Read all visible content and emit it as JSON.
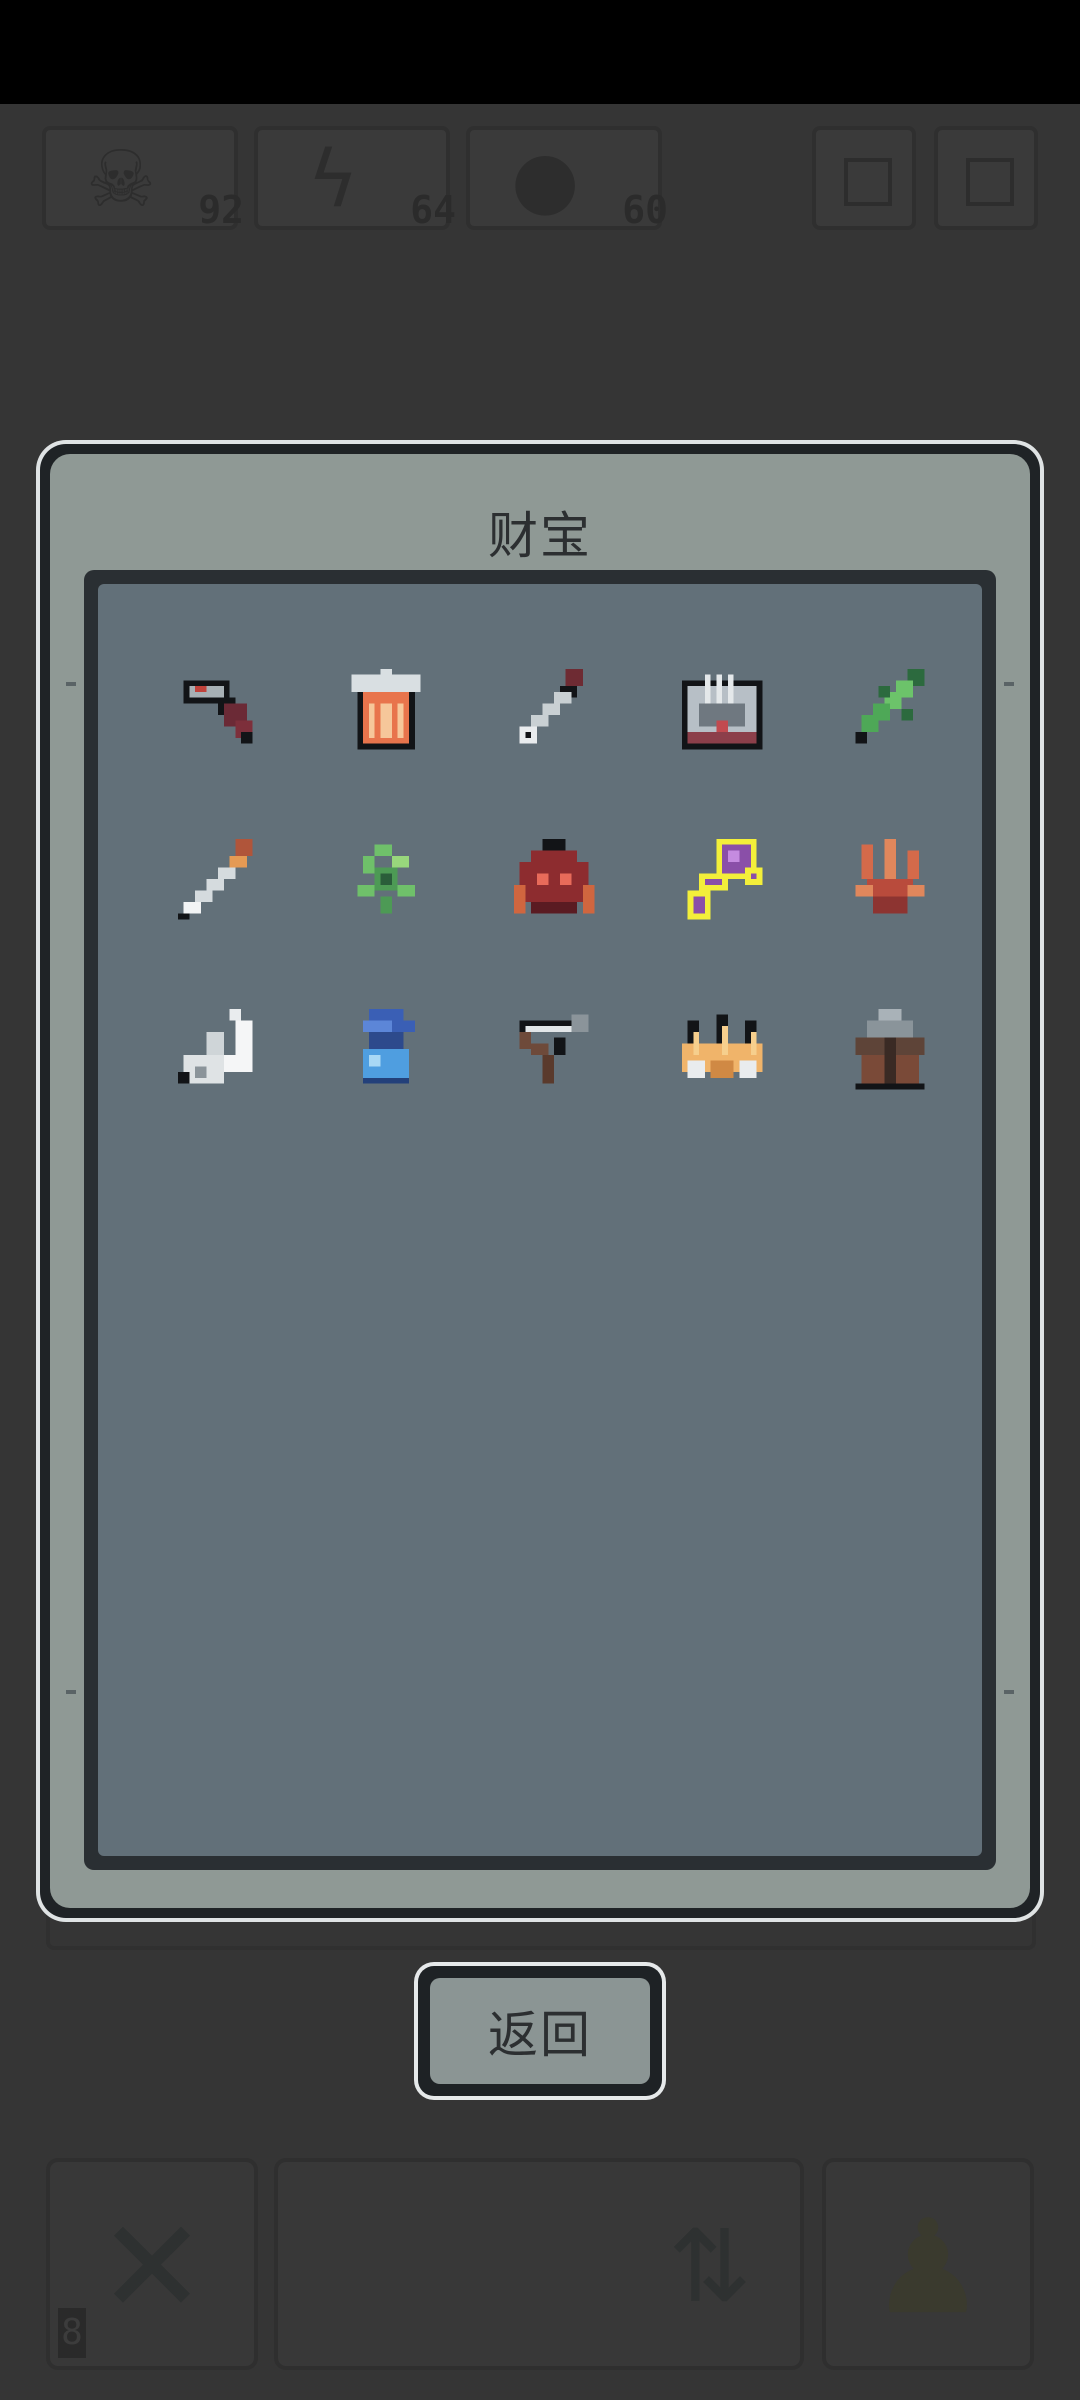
{
  "hud": {
    "stats": [
      {
        "icon": "skull-icon",
        "value": "92"
      },
      {
        "icon": "lightning-icon",
        "value": "64"
      },
      {
        "icon": "slime-icon",
        "value": "60"
      }
    ],
    "buttons": [
      {
        "icon": "map-icon"
      },
      {
        "icon": "menu-icon"
      }
    ]
  },
  "modal": {
    "title": "财宝",
    "items": [
      {
        "icon": "hammer-icon"
      },
      {
        "icon": "barrel-icon"
      },
      {
        "icon": "dagger-icon"
      },
      {
        "icon": "treasure-chest-icon"
      },
      {
        "icon": "green-sword-icon"
      },
      {
        "icon": "short-sword-icon"
      },
      {
        "icon": "green-plant-icon"
      },
      {
        "icon": "red-helmet-icon"
      },
      {
        "icon": "purple-key-icon",
        "selected": true
      },
      {
        "icon": "red-coral-icon"
      },
      {
        "icon": "white-claw-icon"
      },
      {
        "icon": "blue-potion-icon"
      },
      {
        "icon": "slingshot-icon"
      },
      {
        "icon": "golden-crown-icon"
      },
      {
        "icon": "stone-anvil-icon"
      }
    ]
  },
  "back_button": {
    "label": "返回"
  },
  "bottom": {
    "left_badge": "8"
  },
  "colors": {
    "background": "#353535",
    "panel": "#627079",
    "frame": "#8f9995",
    "selected_outline": "#f3ef3a"
  }
}
